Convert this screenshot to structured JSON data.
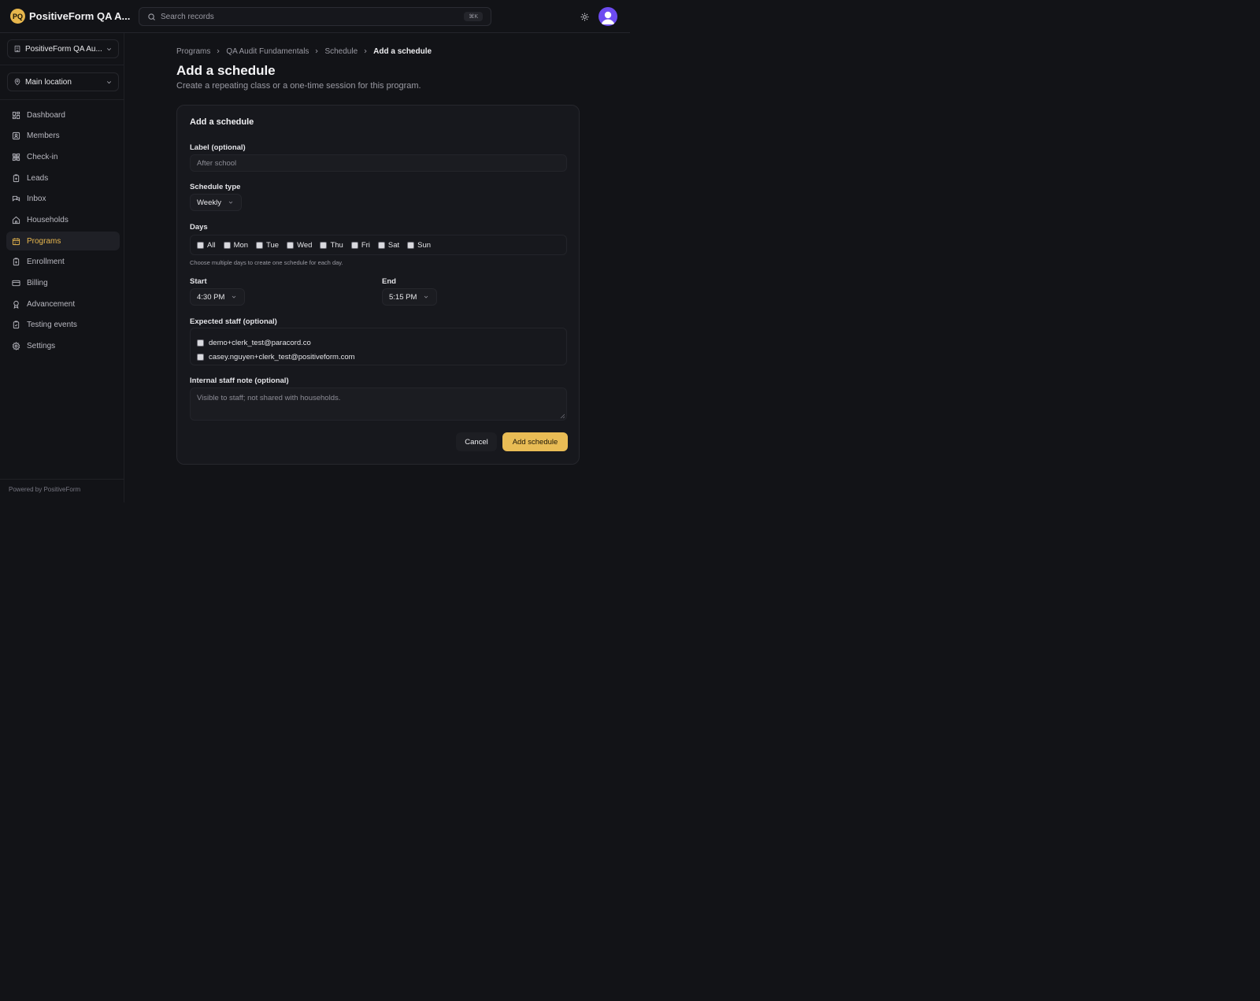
{
  "header": {
    "brand_initials": "PQ",
    "brand_name": "PositiveForm QA A...",
    "search_placeholder": "Search records",
    "search_shortcut": "⌘K"
  },
  "sidebar": {
    "org_name": "PositiveForm QA Au...",
    "location": "Main location",
    "items": [
      {
        "label": "Dashboard",
        "icon": "dashboard-icon"
      },
      {
        "label": "Members",
        "icon": "members-icon"
      },
      {
        "label": "Check-in",
        "icon": "check-in-icon"
      },
      {
        "label": "Leads",
        "icon": "leads-icon"
      },
      {
        "label": "Inbox",
        "icon": "inbox-icon"
      },
      {
        "label": "Households",
        "icon": "home-icon"
      },
      {
        "label": "Programs",
        "icon": "calendar-icon",
        "active": true
      },
      {
        "label": "Enrollment",
        "icon": "enrollment-icon"
      },
      {
        "label": "Billing",
        "icon": "credit-card-icon"
      },
      {
        "label": "Advancement",
        "icon": "award-icon"
      },
      {
        "label": "Testing events",
        "icon": "clipboard-check-icon"
      },
      {
        "label": "Settings",
        "icon": "gear-icon"
      }
    ],
    "footer": "Powered by PositiveForm"
  },
  "breadcrumb": [
    "Programs",
    "QA Audit Fundamentals",
    "Schedule",
    "Add a schedule"
  ],
  "page": {
    "title": "Add a schedule",
    "subtitle": "Create a repeating class or a one-time session for this program."
  },
  "form": {
    "card_title": "Add a schedule",
    "label_field": {
      "label": "Label (optional)",
      "placeholder": "After school"
    },
    "schedule_type": {
      "label": "Schedule type",
      "value": "Weekly"
    },
    "days": {
      "label": "Days",
      "options": [
        "All",
        "Mon",
        "Tue",
        "Wed",
        "Thu",
        "Fri",
        "Sat",
        "Sun"
      ],
      "hint": "Choose multiple days to create one schedule for each day."
    },
    "start": {
      "label": "Start",
      "value": "4:30 PM"
    },
    "end": {
      "label": "End",
      "value": "5:15 PM"
    },
    "staff": {
      "label": "Expected staff (optional)",
      "options": [
        "demo+clerk_test@paracord.co",
        "casey.nguyen+clerk_test@positiveform.com"
      ]
    },
    "note": {
      "label": "Internal staff note (optional)",
      "placeholder": "Visible to staff; not shared with households."
    },
    "cancel_label": "Cancel",
    "submit_label": "Add schedule"
  },
  "colors": {
    "background": "#121317",
    "accent": "#e9bc55",
    "avatar": "#6d4bf0"
  }
}
